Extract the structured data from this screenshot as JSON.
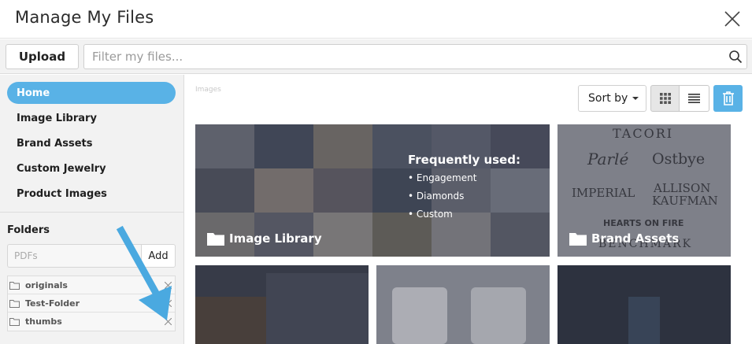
{
  "header": {
    "title": "Manage My Files"
  },
  "toolbar": {
    "upload_label": "Upload",
    "filter_placeholder": "Filter my files..."
  },
  "sidebar": {
    "items": [
      {
        "label": "Home",
        "active": true
      },
      {
        "label": "Image Library"
      },
      {
        "label": "Brand Assets"
      },
      {
        "label": "Custom Jewelry"
      },
      {
        "label": "Product Images"
      }
    ],
    "folders_label": "Folders",
    "folder_input_placeholder": "PDFs",
    "add_label": "Add",
    "folders": [
      "originals",
      "Test-Folder",
      "thumbs"
    ]
  },
  "main": {
    "section_label": "Images",
    "sort_label": "Sort by",
    "tiles": [
      {
        "label": "Image Library"
      },
      {
        "label": "Brand Assets"
      }
    ],
    "frequently_used": {
      "title": "Frequently used:",
      "items": [
        "• Engagement",
        "• Diamonds",
        "• Custom"
      ]
    },
    "brand_logos": [
      "TACORI",
      "Parlé",
      "Ostbye",
      "IMPERIAL",
      "ALLISON",
      "KAUFMAN",
      "HEARTS ON FIRE",
      "BENCHMARK"
    ]
  },
  "colors": {
    "accent": "#59b2e6",
    "sidebar_bg": "#f2f2f2"
  }
}
